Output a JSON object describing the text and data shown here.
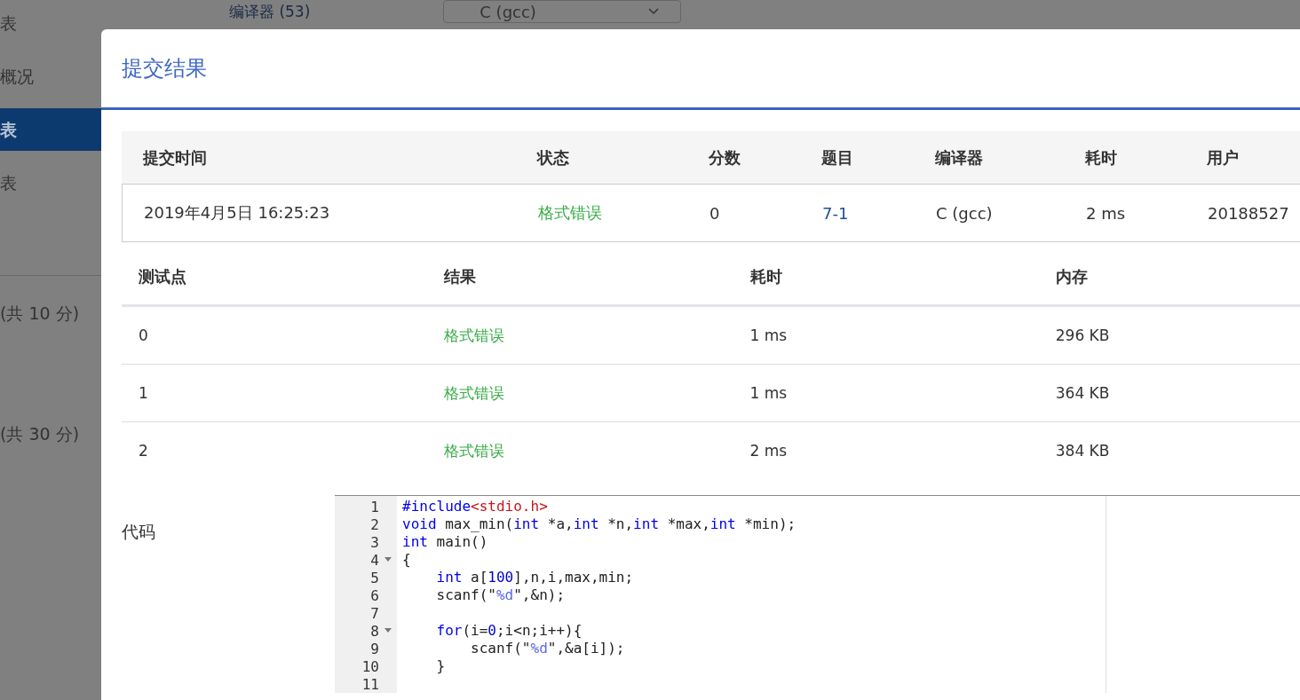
{
  "background": {
    "compiler_label": "编译器 (53)",
    "compiler_select": "C (gcc)",
    "sidebar_items": [
      {
        "label": "表",
        "selected": false
      },
      {
        "label": "概况",
        "selected": false
      },
      {
        "label": "表",
        "selected": true
      },
      {
        "label": "表",
        "selected": false
      }
    ],
    "score_labels": [
      "(共 10 分)",
      "(共 30 分)"
    ]
  },
  "modal": {
    "title": "提交结果",
    "submission_table": {
      "columns": [
        "提交时间",
        "状态",
        "分数",
        "题目",
        "编译器",
        "耗时",
        "用户"
      ],
      "rows": [
        {
          "cells": [
            {
              "text": "2019年4月5日 16:25:23",
              "kind": "text"
            },
            {
              "text": "格式错误",
              "kind": "status"
            },
            {
              "text": "0",
              "kind": "text"
            },
            {
              "text": "7-1",
              "kind": "link"
            },
            {
              "text": "C (gcc)",
              "kind": "text"
            },
            {
              "text": "2 ms",
              "kind": "text"
            },
            {
              "text": "20188527",
              "kind": "text"
            }
          ]
        }
      ]
    },
    "testcase_table": {
      "columns": [
        "测试点",
        "结果",
        "耗时",
        "内存"
      ],
      "rows": [
        {
          "cells": [
            {
              "text": "0",
              "kind": "text"
            },
            {
              "text": "格式错误",
              "kind": "status"
            },
            {
              "text": "1 ms",
              "kind": "text"
            },
            {
              "text": "296 KB",
              "kind": "text"
            }
          ]
        },
        {
          "cells": [
            {
              "text": "1",
              "kind": "text"
            },
            {
              "text": "格式错误",
              "kind": "status"
            },
            {
              "text": "1 ms",
              "kind": "text"
            },
            {
              "text": "364 KB",
              "kind": "text"
            }
          ]
        },
        {
          "cells": [
            {
              "text": "2",
              "kind": "text"
            },
            {
              "text": "格式错误",
              "kind": "status"
            },
            {
              "text": "2 ms",
              "kind": "text"
            },
            {
              "text": "384 KB",
              "kind": "text"
            }
          ]
        }
      ]
    },
    "code_label": "代码",
    "code_lines": [
      {
        "number": "1",
        "foldable": false,
        "tokens": [
          {
            "text": "#include",
            "kind": "keyword"
          },
          {
            "text": "<stdio.h>",
            "kind": "string"
          }
        ]
      },
      {
        "number": "2",
        "foldable": false,
        "tokens": [
          {
            "text": "void",
            "kind": "keyword"
          },
          {
            "text": " max_min(",
            "kind": "plain"
          },
          {
            "text": "int",
            "kind": "keyword"
          },
          {
            "text": " *a,",
            "kind": "plain"
          },
          {
            "text": "int",
            "kind": "keyword"
          },
          {
            "text": " *n,",
            "kind": "plain"
          },
          {
            "text": "int",
            "kind": "keyword"
          },
          {
            "text": " *max,",
            "kind": "plain"
          },
          {
            "text": "int",
            "kind": "keyword"
          },
          {
            "text": " *min);",
            "kind": "plain"
          }
        ]
      },
      {
        "number": "3",
        "foldable": false,
        "tokens": [
          {
            "text": "int",
            "kind": "keyword"
          },
          {
            "text": " main()",
            "kind": "plain"
          }
        ]
      },
      {
        "number": "4",
        "foldable": true,
        "tokens": [
          {
            "text": "{",
            "kind": "plain"
          }
        ]
      },
      {
        "number": "5",
        "foldable": false,
        "tokens": [
          {
            "text": "    int",
            "kind": "keyword"
          },
          {
            "text": " a[",
            "kind": "plain"
          },
          {
            "text": "100",
            "kind": "number"
          },
          {
            "text": "],n,i,max,min;",
            "kind": "plain"
          }
        ]
      },
      {
        "number": "6",
        "foldable": false,
        "tokens": [
          {
            "text": "    scanf(\"",
            "kind": "plain"
          },
          {
            "text": "%d",
            "kind": "format"
          },
          {
            "text": "\",&n);",
            "kind": "plain"
          }
        ]
      },
      {
        "number": "7",
        "foldable": false
      },
      {
        "number": "8",
        "foldable": true,
        "tokens": [
          {
            "text": "    for",
            "kind": "keyword"
          },
          {
            "text": "(i=",
            "kind": "plain"
          },
          {
            "text": "0",
            "kind": "number"
          },
          {
            "text": ";i<n;i++){",
            "kind": "plain"
          }
        ]
      },
      {
        "number": "9",
        "foldable": false,
        "tokens": [
          {
            "text": "        scanf(\"",
            "kind": "plain"
          },
          {
            "text": "%d",
            "kind": "format"
          },
          {
            "text": "\",&a[i]);",
            "kind": "plain"
          }
        ]
      },
      {
        "number": "10",
        "foldable": false,
        "tokens": [
          {
            "text": "    }",
            "kind": "plain"
          }
        ]
      },
      {
        "number": "11",
        "foldable": false
      }
    ]
  }
}
